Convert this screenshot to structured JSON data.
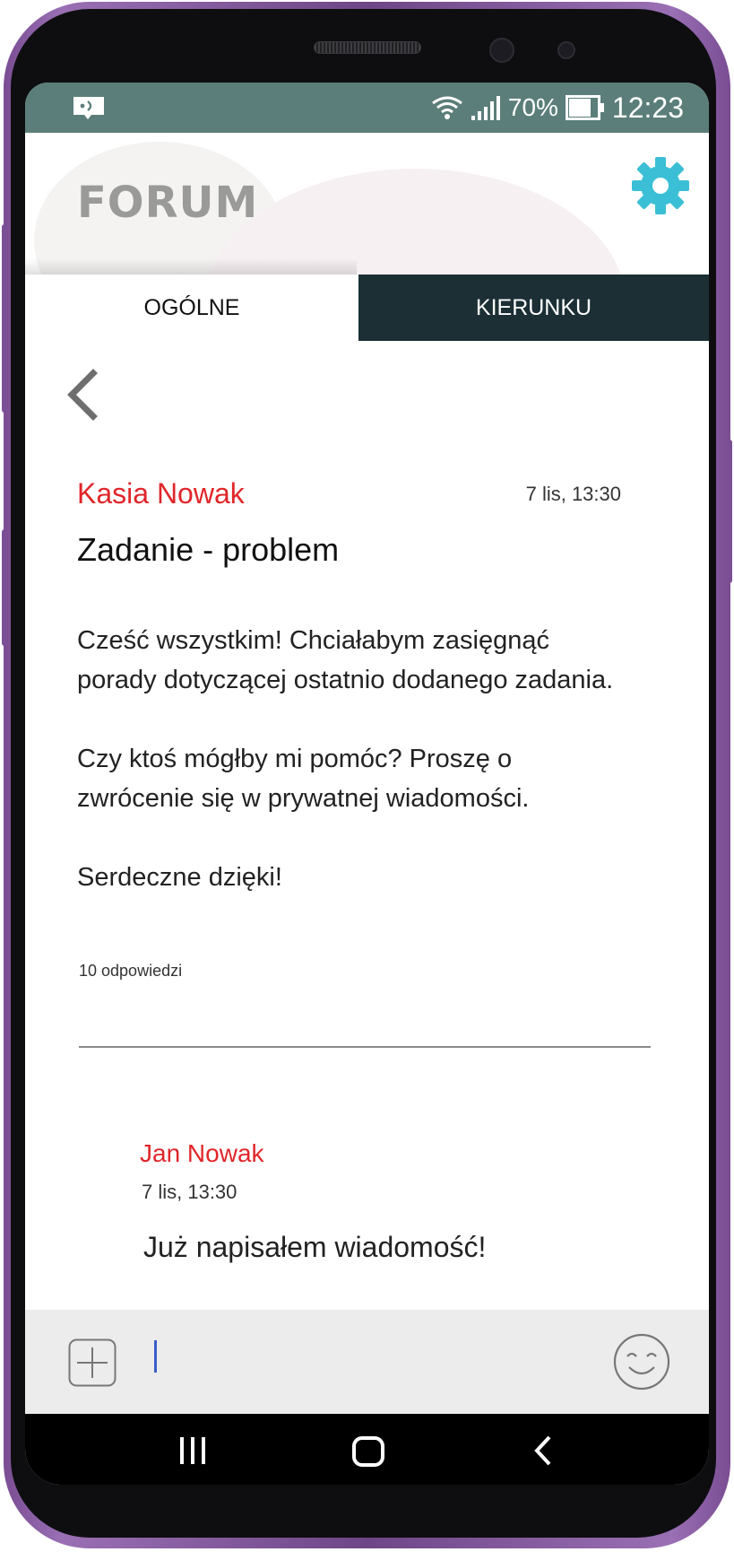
{
  "status_bar": {
    "battery_percent": "70%",
    "time": "12:23",
    "icons": [
      "notification-icon",
      "wifi-icon",
      "signal-icon",
      "battery-icon"
    ]
  },
  "header": {
    "title": "FORUM",
    "settings_icon": "gear-icon",
    "accent_color": "#3bbfd6"
  },
  "tabs": [
    {
      "label": "OGÓLNE",
      "active": true
    },
    {
      "label": "KIERUNKU",
      "active": false
    }
  ],
  "post": {
    "author": "Kasia Nowak",
    "time": "7 lis, 13:30",
    "title": "Zadanie - problem",
    "body": [
      "Cześć wszystkim! Chciałabym zasięgnąć porady dotyczącej ostatnio dodanego zadania.",
      "Czy ktoś mógłby mi pomóc? Proszę o zwrócenie się w prywatnej wiadomości.",
      "Serdeczne dzięki!"
    ],
    "reply_count": "10 odpowiedzi"
  },
  "reply": {
    "author": "Jan Nowak",
    "time": "7 lis, 13:30",
    "text": "Już napisałem wiadomość!"
  },
  "composer": {
    "value": "",
    "attach_icon": "plus-square-icon",
    "emoji_icon": "smiley-icon"
  },
  "colors": {
    "status_bar": "#5b7e7a",
    "tab_inactive_bg": "#1b2f35",
    "author_red": "#e0262a",
    "frame_purple": "#7a4d93"
  }
}
